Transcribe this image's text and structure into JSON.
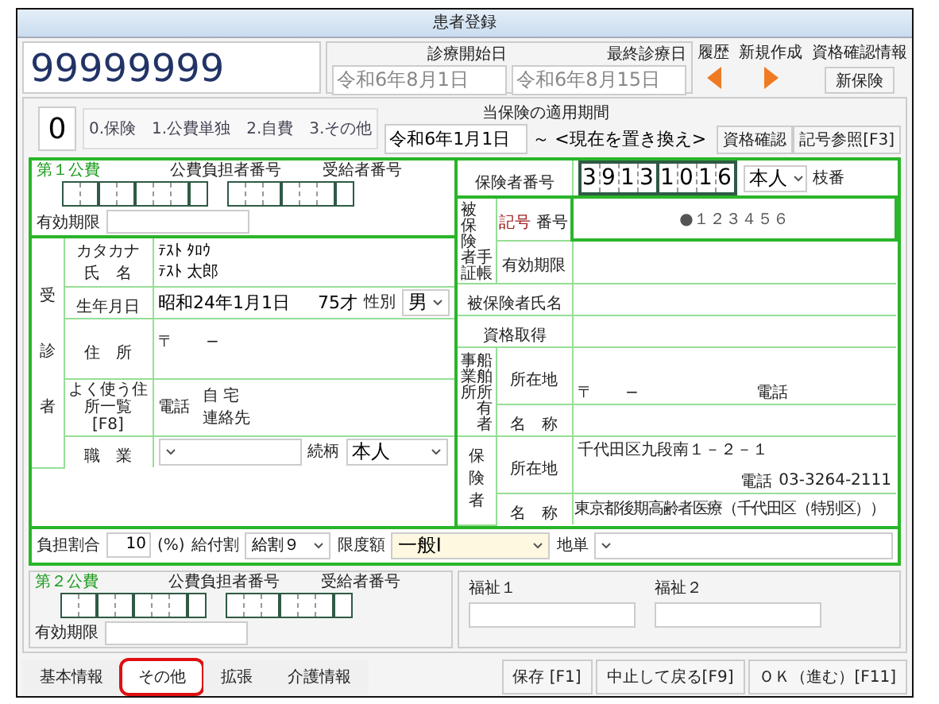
{
  "window": {
    "title": "患者登録"
  },
  "header": {
    "patient_id": "99999999",
    "dates": [
      {
        "label": "診療開始日",
        "value": "令和6年8月1日"
      },
      {
        "label": "最終診療日",
        "value": "令和6年8月15日"
      }
    ],
    "nav": [
      {
        "label": "履歴",
        "kind": "back"
      },
      {
        "label": "新規作成",
        "kind": "forward"
      }
    ],
    "qualification": {
      "label": "資格確認情報",
      "button": "新保険"
    }
  },
  "insurance_kind": {
    "code": "0",
    "options": "0.保険　1.公費単独　2.自費　3.その他"
  },
  "period": {
    "label": "当保険の適用期間",
    "start": "令和6年1月1日",
    "separator": "～",
    "end": "<現在を置き換え>"
  },
  "top_buttons": [
    "資格確認",
    "記号参照[F3]"
  ],
  "public_1": {
    "title": "第１公費",
    "payer_label": "公費負担者番号",
    "recipient_label": "受給者番号",
    "expiry_label": "有効期限"
  },
  "patient": {
    "side_label": "受診者",
    "kana_label": "カタカナ",
    "name_label": "氏　名",
    "kana": "ﾃｽﾄ ﾀﾛｳ",
    "name": "ﾃｽﾄ 太郎",
    "birth_label": "生年月日",
    "birth": "昭和24年1月1日",
    "age": "75才",
    "sex_label": "性別",
    "sex": "男",
    "address_label": "住　所",
    "postal": "〒　　−",
    "address_list_label": "よく使う住所一覧",
    "address_list_key": "[F8]",
    "phone_label": "電話",
    "phone_home_label": "自 宅",
    "phone_contact_label": "連絡先",
    "occupation_label": "職　業",
    "relation_label": "続柄",
    "relation": "本人"
  },
  "insurer": {
    "number_label": "保険者番号",
    "number": "39131016",
    "person": "本人",
    "branch_label": "枝番",
    "card_label": "被保険者証",
    "card_label_2": "手帳",
    "symbol_label": "記号",
    "number_sub_label": "番号",
    "symbol_number": "●１２３４５６",
    "expiry_label": "有効期限",
    "insured_name_label": "被保険者氏名",
    "acquired_label": "資格取得",
    "employer_label": "事業所",
    "ship_owner_label": "船舶所有者",
    "employer_address_label": "所在地",
    "employer_postal": "〒　　−",
    "employer_phone_label": "電話",
    "employer_name_label": "名　称",
    "insurer_label": "保険者",
    "insurer_address_label": "所在地",
    "insurer_address": "千代田区九段南１－２－１",
    "insurer_phone_label": "電話",
    "insurer_phone": "03-3264-2111",
    "insurer_name_label": "名　称",
    "insurer_name": "東京都後期高齢者医療（千代田区（特別区））"
  },
  "burden": {
    "ratio_label": "負担割合",
    "ratio": "10",
    "unit": "(%)",
    "benefit_label": "給付割",
    "benefit": "給割９",
    "limit_label": "限度額",
    "limit": "一般Ⅰ",
    "local_label": "地単"
  },
  "public_2": {
    "title": "第２公費",
    "payer_label": "公費負担者番号",
    "recipient_label": "受給者番号",
    "expiry_label": "有効期限"
  },
  "welfare": [
    {
      "label": "福祉１"
    },
    {
      "label": "福祉２"
    }
  ],
  "tabs": [
    {
      "label": "基本情報",
      "selected": false,
      "highlighted": false
    },
    {
      "label": "その他",
      "selected": true,
      "highlighted": true
    },
    {
      "label": "拡張",
      "selected": false,
      "highlighted": false
    },
    {
      "label": "介護情報",
      "selected": false,
      "highlighted": false
    }
  ],
  "actions": [
    "保存 [F1]",
    "中止して戻る[F9]",
    "ＯＫ（進む）[F11]"
  ]
}
